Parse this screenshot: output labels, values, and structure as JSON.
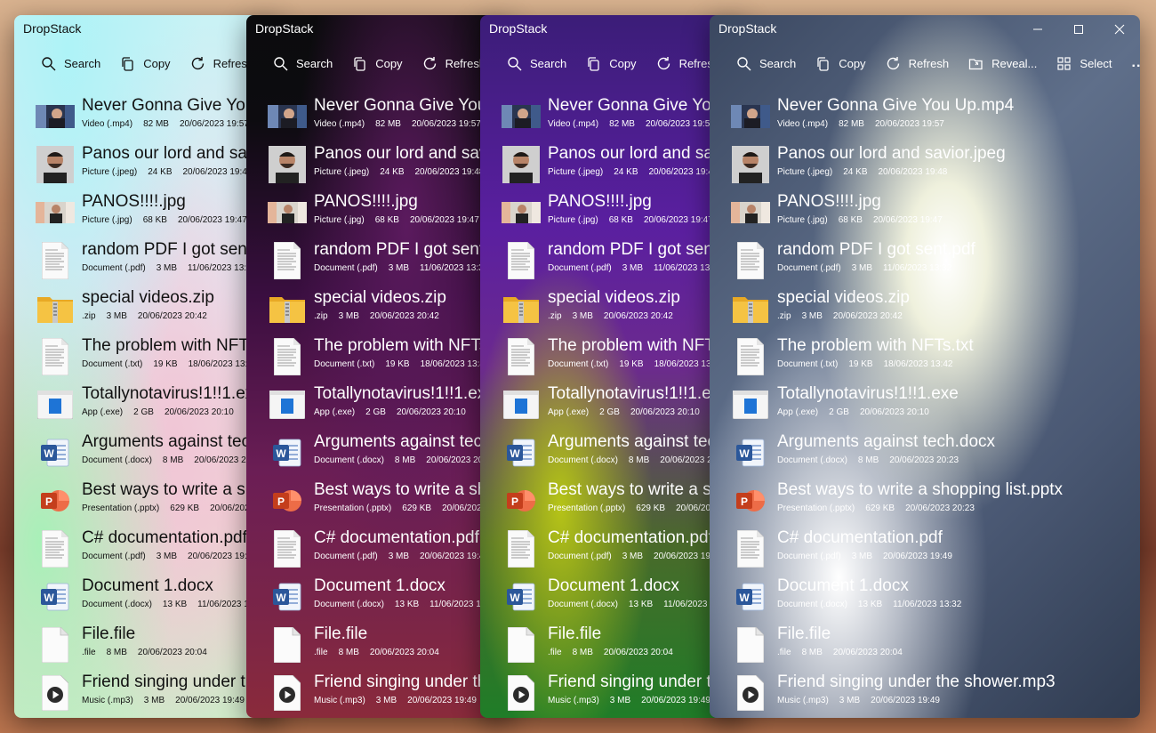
{
  "windows": [
    {
      "id": "w1",
      "title": "DropStack"
    },
    {
      "id": "w2",
      "title": "DropStack"
    },
    {
      "id": "w3",
      "title": "DropStack"
    },
    {
      "id": "w4",
      "title": "DropStack"
    }
  ],
  "toolbar": {
    "search": "Search",
    "copy": "Copy",
    "refresh": "Refresh",
    "reveal": "Reveal...",
    "select": "Select",
    "more": "..."
  },
  "files": [
    {
      "name": "Never Gonna Give You Up.mp4",
      "type": "Video (.mp4)",
      "size": "82 MB",
      "date": "20/06/2023 19:57",
      "icon": "video-thumbnail-icon"
    },
    {
      "name": "Panos our lord and savior.jpeg",
      "type": "Picture (.jpeg)",
      "size": "24 KB",
      "date": "20/06/2023 19:48",
      "icon": "portrait-thumbnail-icon"
    },
    {
      "name": "PANOS!!!!.jpg",
      "type": "Picture (.jpg)",
      "size": "68 KB",
      "date": "20/06/2023 19:47",
      "icon": "photo-thumbnail-icon"
    },
    {
      "name": "random PDF I got sent.pdf",
      "type": "Document (.pdf)",
      "size": "3 MB",
      "date": "11/06/2023 13:32",
      "icon": "document-page-icon"
    },
    {
      "name": "special videos.zip",
      "type": ".zip",
      "size": "3 MB",
      "date": "20/06/2023 20:42",
      "icon": "zip-folder-icon"
    },
    {
      "name": "The problem with NFTs.txt",
      "type": "Document (.txt)",
      "size": "19 KB",
      "date": "18/06/2023 13:42",
      "icon": "document-page-icon"
    },
    {
      "name": "Totallynotavirus!1!!1.exe",
      "type": "App (.exe)",
      "size": "2 GB",
      "date": "20/06/2023 20:10",
      "icon": "app-window-icon"
    },
    {
      "name": "Arguments against tech.docx",
      "type": "Document (.docx)",
      "size": "8 MB",
      "date": "20/06/2023 20:23",
      "icon": "word-icon"
    },
    {
      "name": "Best ways to write a shopping list.pptx",
      "type": "Presentation (.pptx)",
      "size": "629 KB",
      "date": "20/06/2023 20:23",
      "icon": "powerpoint-icon"
    },
    {
      "name": "C# documentation.pdf",
      "type": "Document (.pdf)",
      "size": "3 MB",
      "date": "20/06/2023 19:49",
      "icon": "document-page-icon"
    },
    {
      "name": "Document 1.docx",
      "type": "Document (.docx)",
      "size": "13 KB",
      "date": "11/06/2023 13:32",
      "icon": "word-icon"
    },
    {
      "name": "File.file",
      "type": ".file",
      "size": "8 MB",
      "date": "20/06/2023 20:04",
      "icon": "blank-file-icon"
    },
    {
      "name": "Friend singing under the shower.mp3",
      "type": "Music (.mp3)",
      "size": "3 MB",
      "date": "20/06/2023 19:49",
      "icon": "music-play-icon"
    }
  ],
  "colors": {
    "word": "#2b579a",
    "powerpoint": "#c43e1c",
    "zip": "#f5c343"
  }
}
